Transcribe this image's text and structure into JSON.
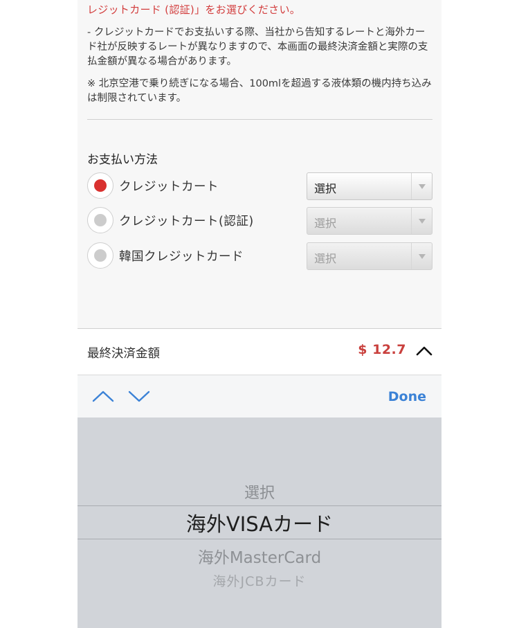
{
  "notice": {
    "red_line": "レジットカード (認証)」をお選びください。",
    "paragraph1": "- クレジットカードでお支払いする際、当社から告知するレートと海外カード社が反映するレートが異なりますので、本画面の最終決済金額と実際の支払金額が異なる場合があります。",
    "paragraph2": "※ 北京空港で乗り続ぎになる場合、100mlを超過する液体類の機内持ち込みは制限されています。"
  },
  "payment": {
    "title": "お支払い方法",
    "options": [
      {
        "label": "クレジットカート",
        "selected": true,
        "select_value": "選択",
        "enabled": true
      },
      {
        "label": "クレジットカート(認証)",
        "selected": false,
        "select_value": "選択",
        "enabled": false
      },
      {
        "label": "韓国クレジットカード",
        "selected": false,
        "select_value": "選択",
        "enabled": false
      }
    ]
  },
  "total": {
    "label": "最終決済金額",
    "amount": "$ 12.7",
    "toggle_icon": "chevron-up-icon"
  },
  "accessory": {
    "prev_icon": "chevron-up-icon",
    "next_icon": "chevron-down-icon",
    "done_label": "Done"
  },
  "picker": {
    "items": [
      "選択",
      "海外VISAカード",
      "海外MasterCard",
      "海外JCBカード"
    ],
    "selected_index": 1
  },
  "colors": {
    "accent_red": "#d9312f",
    "price_red": "#c9403d",
    "ios_blue": "#3b82d6",
    "picker_bg": "#d1d4d9"
  }
}
